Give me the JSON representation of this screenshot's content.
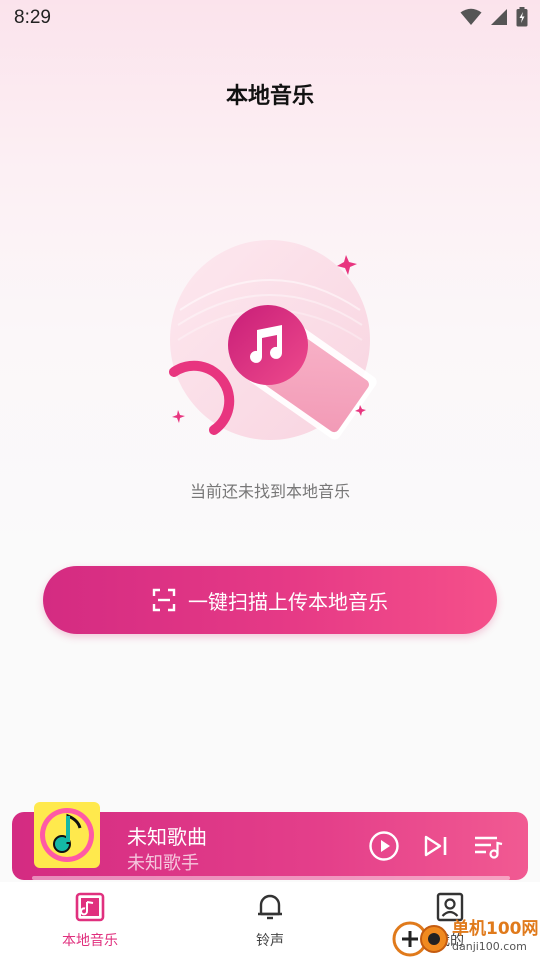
{
  "status_bar": {
    "time": "8:29"
  },
  "header": {
    "title": "本地音乐"
  },
  "empty_state": {
    "message": "当前还未找到本地音乐"
  },
  "scan_button": {
    "label": "一键扫描上传本地音乐"
  },
  "player": {
    "song_title": "未知歌曲",
    "artist": "未知歌手",
    "progress": 0
  },
  "tabs": [
    {
      "label": "本地音乐",
      "icon": "music-note-icon",
      "active": true
    },
    {
      "label": "铃声",
      "icon": "bell-icon",
      "active": false
    },
    {
      "label": "我的",
      "icon": "profile-icon",
      "active": false
    }
  ],
  "watermark": {
    "brand": "单机100网",
    "url": "danji100.com"
  },
  "colors": {
    "accent": "#e0307e",
    "accent_gradient_start": "#d42b82",
    "accent_gradient_end": "#f5508a",
    "album_bg": "#ffe94d"
  }
}
